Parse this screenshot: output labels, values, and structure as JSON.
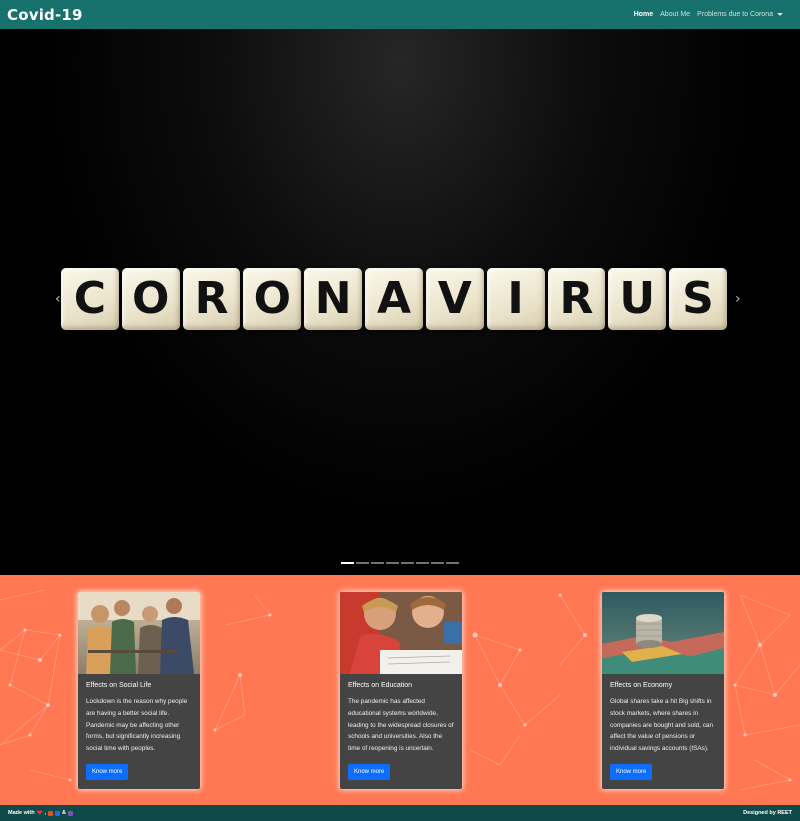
{
  "navbar": {
    "brand": "Covid-19",
    "links": [
      "Home",
      "About Me",
      "Problems due to Corona"
    ]
  },
  "carousel": {
    "tiles": [
      "C",
      "O",
      "R",
      "O",
      "N",
      "A",
      "V",
      "I",
      "R",
      "U",
      "S"
    ],
    "prev_icon": "chevron-left-icon",
    "next_icon": "chevron-right-icon",
    "slide_count": 8,
    "active_slide": 1
  },
  "cards": [
    {
      "title": "Effects on Social Life",
      "text": "Lockdown is the reason why people are having a better social life. Pandemic may be affecting other forms, but significantly increasing social time with peoples.",
      "button": "Know more"
    },
    {
      "title": "Effects on Education",
      "text": "The pandemic has affected educational systems worldwide, leading to the widespread closures of schools and universities. Also the time of reopening is uncertain.",
      "button": "Know more"
    },
    {
      "title": "Effects on Economy",
      "text": "Global shares take a hit Big shifts in stock markets, where shares in companies are bought and sold, can affect the value of pensions or individual savings accounts (ISAs).",
      "button": "Know more"
    }
  ],
  "footer": {
    "made_with": "Made with",
    "heart": "❤",
    "separator": ",",
    "and": "&",
    "designed_by": "Designed by REET"
  },
  "colors": {
    "navbar": "#17726d",
    "cards_bg": "#ff7853",
    "footer": "#0e4a48",
    "button": "#0d6efd"
  }
}
